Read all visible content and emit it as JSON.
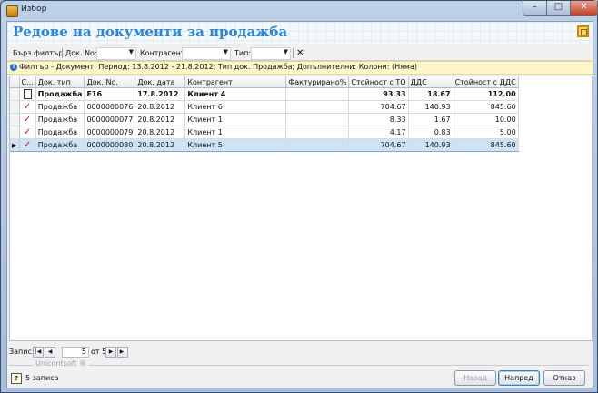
{
  "window": {
    "title": "Избор",
    "minimize": "–",
    "maximize": "□",
    "close": "✕"
  },
  "header": {
    "title": "Редове на документи за продажба"
  },
  "toolbar": {
    "quick_filter": "Бърз филтър",
    "doc_no_label": "Док. No:",
    "doc_no_value": "",
    "partner_label": "Контрагент:",
    "partner_value": "",
    "type_label": "Тип:",
    "type_value": "",
    "clear": "✕"
  },
  "filter": {
    "text": "Филтър - Документ: Период: 13.8.2012 - 21.8.2012; Тип док. Продажба; Допълнителни: Колони: (Няма)"
  },
  "grid": {
    "columns": [
      "С...",
      "Док. тип",
      "Док. No.",
      "Док. дата",
      "Контрагент",
      "Фактурирано%",
      "Стойност с ТО",
      "ДДС",
      "Стойност с ДДС"
    ],
    "rows": [
      {
        "status": "doc",
        "type": "Продажба",
        "no": "E16",
        "date": "17.8.2012",
        "partner": "Клиент 4",
        "invoiced": "",
        "value": "93.33",
        "vat": "18.67",
        "total": "112.00",
        "bold": true
      },
      {
        "status": "check",
        "type": "Продажба",
        "no": "0000000076",
        "date": "20.8.2012",
        "partner": "Клиент 6",
        "invoiced": "",
        "value": "704.67",
        "vat": "140.93",
        "total": "845.60"
      },
      {
        "status": "check",
        "type": "Продажба",
        "no": "0000000077",
        "date": "20.8.2012",
        "partner": "Клиент 1",
        "invoiced": "",
        "value": "8.33",
        "vat": "1.67",
        "total": "10.00"
      },
      {
        "status": "check",
        "type": "Продажба",
        "no": "0000000079",
        "date": "20.8.2012",
        "partner": "Клиент 1",
        "invoiced": "",
        "value": "4.17",
        "vat": "0.83",
        "total": "5.00"
      },
      {
        "status": "check",
        "type": "Продажба",
        "no": "0000000080",
        "date": "20.8.2012",
        "partner": "Клиент 5",
        "invoiced": "",
        "value": "704.67",
        "vat": "140.93",
        "total": "845.60",
        "selected": true
      }
    ]
  },
  "navigator": {
    "label": "Запис:",
    "current": "5",
    "of": "от 5"
  },
  "footer": {
    "brand": "Unicontsoft ®",
    "help": "?",
    "records": "5 записа"
  },
  "buttons": {
    "back": "Назад",
    "next": "Напред",
    "cancel": "Отказ"
  }
}
